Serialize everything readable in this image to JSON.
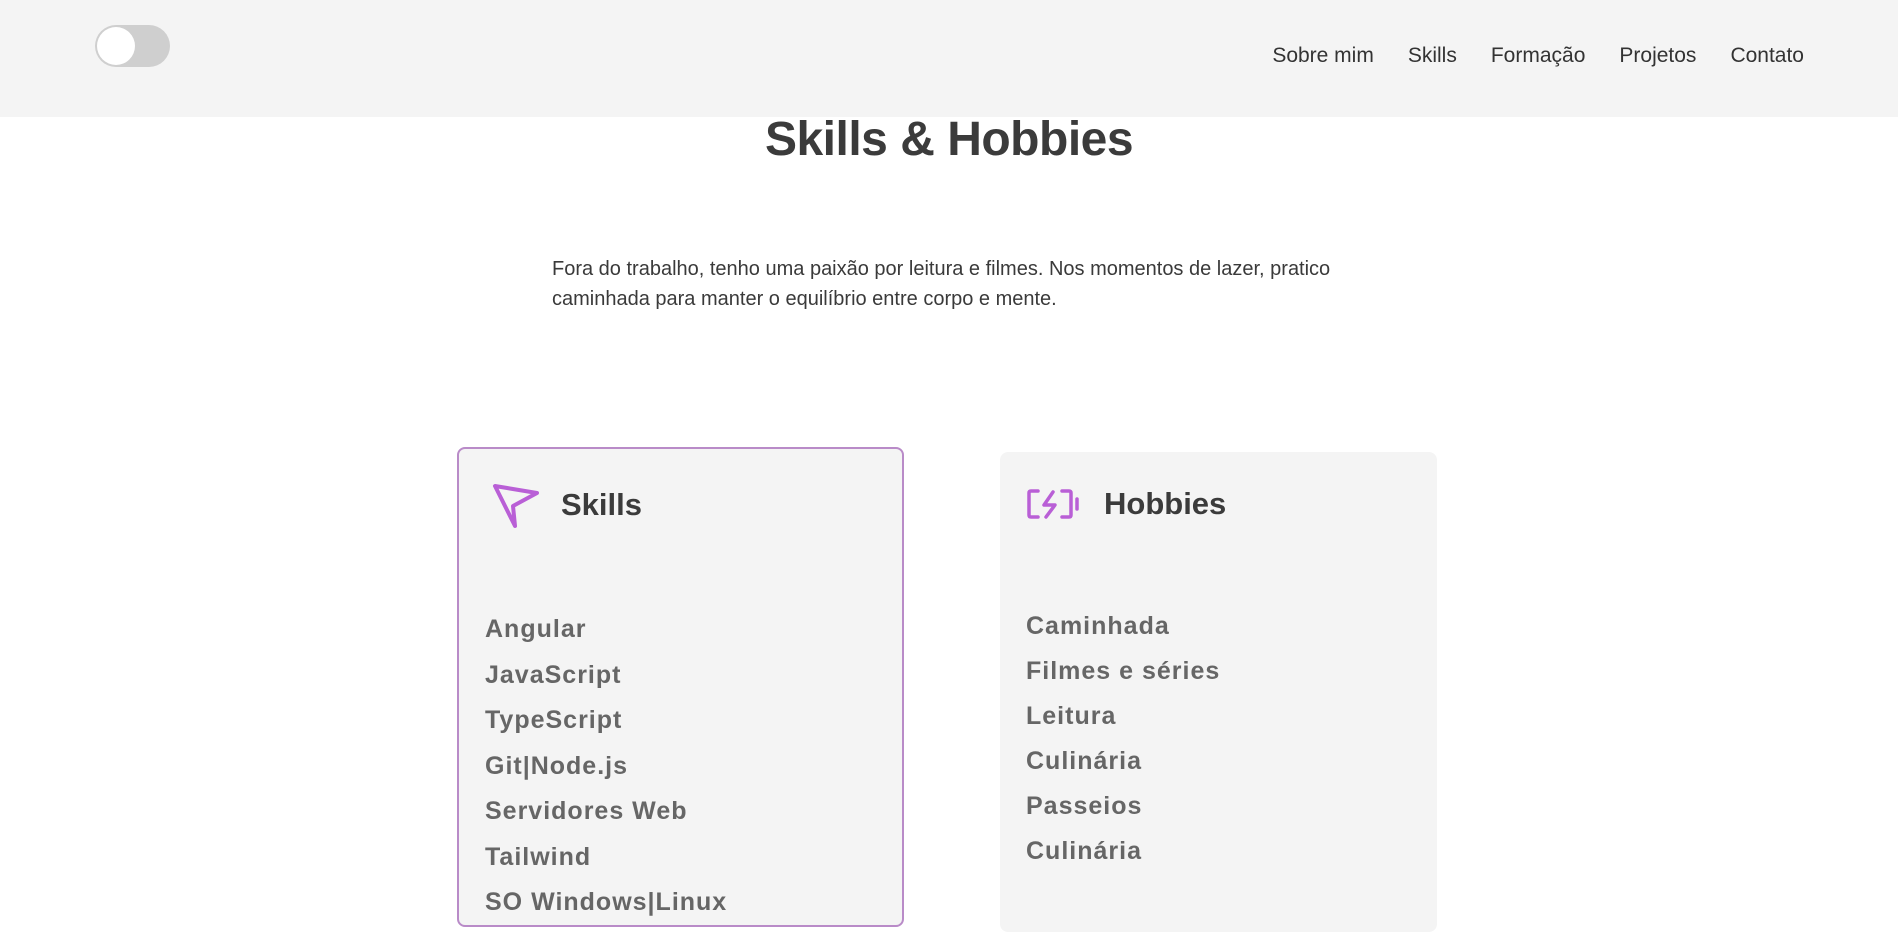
{
  "nav": {
    "links": [
      "Sobre mim",
      "Skills",
      "Formação",
      "Projetos",
      "Contato"
    ]
  },
  "header": {
    "title": "Skills & Hobbies",
    "intro": "Fora do trabalho, tenho uma paixão por leitura e filmes. Nos momentos de lazer, pratico caminhada para manter o equilíbrio entre corpo e mente."
  },
  "skills": {
    "title": "Skills",
    "icon": "send-arrow-icon",
    "items": [
      "Angular",
      "JavaScript",
      "TypeScript",
      "Git|Node.js",
      "Servidores Web",
      "Tailwind",
      "SO Windows|Linux"
    ]
  },
  "hobbies": {
    "title": "Hobbies",
    "icon": "battery-charging-icon",
    "items": [
      "Caminhada",
      "Filmes e séries",
      "Leitura",
      "Culinária",
      "Passeios",
      "Culinária"
    ]
  },
  "colors": {
    "accent": "#b95fd6",
    "card_border": "#b98bc8",
    "navbar_bg": "#f4f4f4",
    "card_bg": "#f4f4f4",
    "toggle_bg": "#cfcfcf"
  }
}
